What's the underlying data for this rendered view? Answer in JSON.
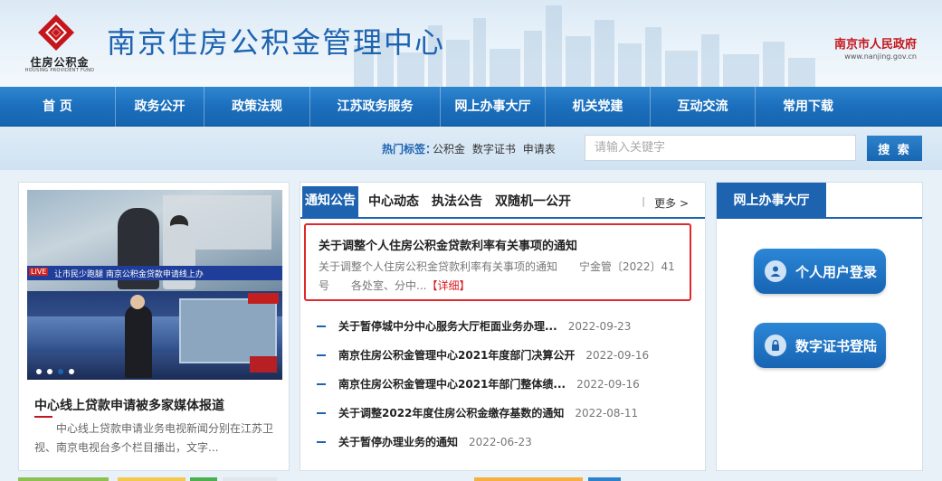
{
  "header": {
    "logo_text": "住房公积金",
    "logo_en": "HOUSING PROVIDENT FUND",
    "site_title": "南京住房公积金管理中心",
    "gov_name": "南京市人民政府",
    "gov_url": "www.nanjing.gov.cn"
  },
  "nav": {
    "items": [
      {
        "label": "首 页"
      },
      {
        "label": "政务公开"
      },
      {
        "label": "政策法规"
      },
      {
        "label": "江苏政务服务"
      },
      {
        "label": "网上办事大厅"
      },
      {
        "label": "机关党建"
      },
      {
        "label": "互动交流"
      },
      {
        "label": "常用下载"
      }
    ]
  },
  "search": {
    "hot_label": "热门标签：",
    "hot_tags": [
      "公积金",
      "数字证书",
      "申请表"
    ],
    "placeholder": "请输入关键字",
    "button_label": "搜 索"
  },
  "left_panel": {
    "photo_ticker_tag": "LIVE",
    "photo_ticker": "让市民少跑腿 南京公积金贷款申请线上办",
    "lead_title": "中心线上贷款申请被多家媒体报道",
    "lead_summary": "中心线上贷款申请业务电视新闻分别在江苏卫视、南京电视台多个栏目播出，文字..."
  },
  "mid_panel": {
    "tabs": [
      {
        "label": "通知公告",
        "active": true
      },
      {
        "label": "中心动态",
        "active": false
      },
      {
        "label": "执法公告",
        "active": false
      },
      {
        "label": "双随机一公开",
        "active": false
      }
    ],
    "more_sep": "|",
    "more_label": "更多 >",
    "featured": {
      "title": "关于调整个人住房公积金贷款利率有关事项的通知",
      "summary": "关于调整个人住房公积金贷款利率有关事项的通知　　宁金管〔2022〕41号　　各处室、分中...",
      "detail_label": "【详细】"
    },
    "news": [
      {
        "title": "关于暂停城中分中心服务大厅柜面业务办理...",
        "date": "2022-09-23"
      },
      {
        "title": "南京住房公积金管理中心2021年度部门决算公开",
        "date": "2022-09-16"
      },
      {
        "title": "南京住房公积金管理中心2021年部门整体绩...",
        "date": "2022-09-16"
      },
      {
        "title": "关于调整2022年度住房公积金缴存基数的通知",
        "date": "2022-08-11"
      },
      {
        "title": "关于暂停办理业务的通知",
        "date": "2022-06-23"
      }
    ]
  },
  "right_panel": {
    "tab_label": "网上办事大厅",
    "buttons": [
      {
        "label": "个人用户登录",
        "icon": "user-icon"
      },
      {
        "label": "数字证书登陆",
        "icon": "certificate-icon"
      }
    ]
  },
  "colors": {
    "brand_blue": "#1d63b0",
    "accent_red": "#c4161c",
    "highlight_border": "#e0292c"
  }
}
